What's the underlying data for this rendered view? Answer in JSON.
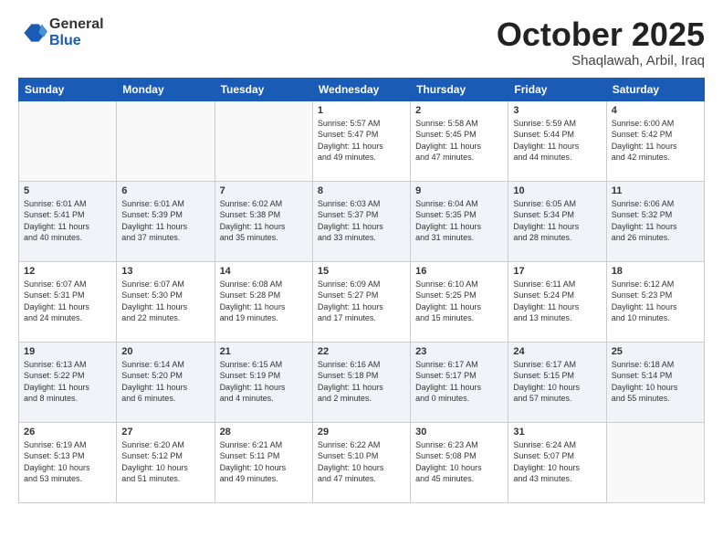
{
  "logo": {
    "general": "General",
    "blue": "Blue"
  },
  "header": {
    "month": "October 2025",
    "location": "Shaqlawah, Arbil, Iraq"
  },
  "weekdays": [
    "Sunday",
    "Monday",
    "Tuesday",
    "Wednesday",
    "Thursday",
    "Friday",
    "Saturday"
  ],
  "weeks": [
    [
      {
        "day": "",
        "info": ""
      },
      {
        "day": "",
        "info": ""
      },
      {
        "day": "",
        "info": ""
      },
      {
        "day": "1",
        "info": "Sunrise: 5:57 AM\nSunset: 5:47 PM\nDaylight: 11 hours\nand 49 minutes."
      },
      {
        "day": "2",
        "info": "Sunrise: 5:58 AM\nSunset: 5:45 PM\nDaylight: 11 hours\nand 47 minutes."
      },
      {
        "day": "3",
        "info": "Sunrise: 5:59 AM\nSunset: 5:44 PM\nDaylight: 11 hours\nand 44 minutes."
      },
      {
        "day": "4",
        "info": "Sunrise: 6:00 AM\nSunset: 5:42 PM\nDaylight: 11 hours\nand 42 minutes."
      }
    ],
    [
      {
        "day": "5",
        "info": "Sunrise: 6:01 AM\nSunset: 5:41 PM\nDaylight: 11 hours\nand 40 minutes."
      },
      {
        "day": "6",
        "info": "Sunrise: 6:01 AM\nSunset: 5:39 PM\nDaylight: 11 hours\nand 37 minutes."
      },
      {
        "day": "7",
        "info": "Sunrise: 6:02 AM\nSunset: 5:38 PM\nDaylight: 11 hours\nand 35 minutes."
      },
      {
        "day": "8",
        "info": "Sunrise: 6:03 AM\nSunset: 5:37 PM\nDaylight: 11 hours\nand 33 minutes."
      },
      {
        "day": "9",
        "info": "Sunrise: 6:04 AM\nSunset: 5:35 PM\nDaylight: 11 hours\nand 31 minutes."
      },
      {
        "day": "10",
        "info": "Sunrise: 6:05 AM\nSunset: 5:34 PM\nDaylight: 11 hours\nand 28 minutes."
      },
      {
        "day": "11",
        "info": "Sunrise: 6:06 AM\nSunset: 5:32 PM\nDaylight: 11 hours\nand 26 minutes."
      }
    ],
    [
      {
        "day": "12",
        "info": "Sunrise: 6:07 AM\nSunset: 5:31 PM\nDaylight: 11 hours\nand 24 minutes."
      },
      {
        "day": "13",
        "info": "Sunrise: 6:07 AM\nSunset: 5:30 PM\nDaylight: 11 hours\nand 22 minutes."
      },
      {
        "day": "14",
        "info": "Sunrise: 6:08 AM\nSunset: 5:28 PM\nDaylight: 11 hours\nand 19 minutes."
      },
      {
        "day": "15",
        "info": "Sunrise: 6:09 AM\nSunset: 5:27 PM\nDaylight: 11 hours\nand 17 minutes."
      },
      {
        "day": "16",
        "info": "Sunrise: 6:10 AM\nSunset: 5:25 PM\nDaylight: 11 hours\nand 15 minutes."
      },
      {
        "day": "17",
        "info": "Sunrise: 6:11 AM\nSunset: 5:24 PM\nDaylight: 11 hours\nand 13 minutes."
      },
      {
        "day": "18",
        "info": "Sunrise: 6:12 AM\nSunset: 5:23 PM\nDaylight: 11 hours\nand 10 minutes."
      }
    ],
    [
      {
        "day": "19",
        "info": "Sunrise: 6:13 AM\nSunset: 5:22 PM\nDaylight: 11 hours\nand 8 minutes."
      },
      {
        "day": "20",
        "info": "Sunrise: 6:14 AM\nSunset: 5:20 PM\nDaylight: 11 hours\nand 6 minutes."
      },
      {
        "day": "21",
        "info": "Sunrise: 6:15 AM\nSunset: 5:19 PM\nDaylight: 11 hours\nand 4 minutes."
      },
      {
        "day": "22",
        "info": "Sunrise: 6:16 AM\nSunset: 5:18 PM\nDaylight: 11 hours\nand 2 minutes."
      },
      {
        "day": "23",
        "info": "Sunrise: 6:17 AM\nSunset: 5:17 PM\nDaylight: 11 hours\nand 0 minutes."
      },
      {
        "day": "24",
        "info": "Sunrise: 6:17 AM\nSunset: 5:15 PM\nDaylight: 10 hours\nand 57 minutes."
      },
      {
        "day": "25",
        "info": "Sunrise: 6:18 AM\nSunset: 5:14 PM\nDaylight: 10 hours\nand 55 minutes."
      }
    ],
    [
      {
        "day": "26",
        "info": "Sunrise: 6:19 AM\nSunset: 5:13 PM\nDaylight: 10 hours\nand 53 minutes."
      },
      {
        "day": "27",
        "info": "Sunrise: 6:20 AM\nSunset: 5:12 PM\nDaylight: 10 hours\nand 51 minutes."
      },
      {
        "day": "28",
        "info": "Sunrise: 6:21 AM\nSunset: 5:11 PM\nDaylight: 10 hours\nand 49 minutes."
      },
      {
        "day": "29",
        "info": "Sunrise: 6:22 AM\nSunset: 5:10 PM\nDaylight: 10 hours\nand 47 minutes."
      },
      {
        "day": "30",
        "info": "Sunrise: 6:23 AM\nSunset: 5:08 PM\nDaylight: 10 hours\nand 45 minutes."
      },
      {
        "day": "31",
        "info": "Sunrise: 6:24 AM\nSunset: 5:07 PM\nDaylight: 10 hours\nand 43 minutes."
      },
      {
        "day": "",
        "info": ""
      }
    ]
  ]
}
